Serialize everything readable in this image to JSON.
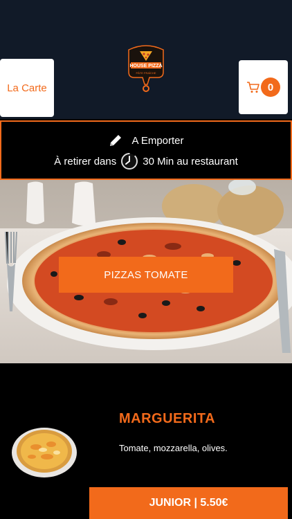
{
  "header": {
    "menu_label": "La Carte",
    "cart_count": "0",
    "logo": {
      "name": "HOUSE PIZZA",
      "tagline": "PÂTE FRAÎCHE"
    }
  },
  "order_info": {
    "mode": "A Emporter",
    "pickup_prefix": "À retirer dans",
    "pickup_time": "30 Min au restaurant"
  },
  "hero": {
    "category_label": "PIZZAS TOMATE"
  },
  "product": {
    "name": "MARGUERITA",
    "description": "Tomate, mozzarella, olives.",
    "price_label": "JUNIOR | 5.50€"
  },
  "colors": {
    "accent": "#f26a1b",
    "header_bg": "#111a28",
    "page_bg": "#000000"
  }
}
